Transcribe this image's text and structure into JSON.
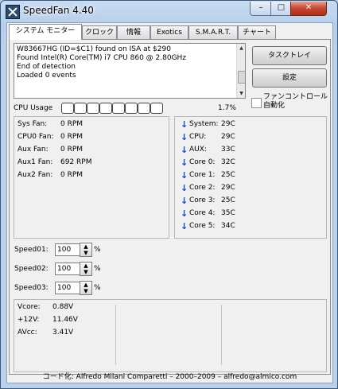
{
  "window": {
    "title": "SpeedFan 4.40"
  },
  "titlebar": {
    "minimize": "–",
    "maximize": "□",
    "close": "✕"
  },
  "tabs": [
    {
      "label": "システム モニター"
    },
    {
      "label": "クロック"
    },
    {
      "label": "情報"
    },
    {
      "label": "Exotics"
    },
    {
      "label": "S.M.A.R.T."
    },
    {
      "label": "チャート"
    }
  ],
  "log": {
    "lines": [
      "W83667HG (ID=$C1) found on ISA at $290",
      "Found Intel(R) Core(TM) i7 CPU 860 @ 2.80GHz",
      "End of detection",
      "Loaded 0 events"
    ]
  },
  "buttons": {
    "tasktray": "タスクトレイ",
    "settings": "設定"
  },
  "auto_fan": {
    "label": "ファンコントロール自動化",
    "checked": false
  },
  "cpu": {
    "label": "CPU Usage",
    "bar_count": 8,
    "percent": "1.7%"
  },
  "fans": [
    {
      "name": "Sys Fan:",
      "value": "0 RPM"
    },
    {
      "name": "CPU0 Fan:",
      "value": "0 RPM"
    },
    {
      "name": "Aux Fan:",
      "value": "0 RPM"
    },
    {
      "name": "Aux1 Fan:",
      "value": "692 RPM"
    },
    {
      "name": "Aux2 Fan:",
      "value": "0 RPM"
    }
  ],
  "temps": [
    {
      "name": "System:",
      "value": "29C"
    },
    {
      "name": "CPU:",
      "value": "29C"
    },
    {
      "name": "AUX:",
      "value": "33C"
    },
    {
      "name": "Core 0:",
      "value": "32C"
    },
    {
      "name": "Core 1:",
      "value": "25C"
    },
    {
      "name": "Core 2:",
      "value": "29C"
    },
    {
      "name": "Core 3:",
      "value": "25C"
    },
    {
      "name": "Core 4:",
      "value": "35C"
    },
    {
      "name": "Core 5:",
      "value": "34C"
    }
  ],
  "arrow_icon": "down-arrow-icon",
  "arrow_color": "#1740d0",
  "speeds": [
    {
      "label": "Speed01:",
      "value": "100",
      "unit": "%"
    },
    {
      "label": "Speed02:",
      "value": "100",
      "unit": "%"
    },
    {
      "label": "Speed03:",
      "value": "100",
      "unit": "%"
    }
  ],
  "voltages": [
    {
      "name": "Vcore:",
      "value": "0.88V"
    },
    {
      "name": "+12V:",
      "value": "11.46V"
    },
    {
      "name": "AVcc:",
      "value": "3.41V"
    }
  ],
  "footer": {
    "text": "コード化: Alfredo Milani Comparetti – 2000–2009 – alfredo@almico.com"
  }
}
